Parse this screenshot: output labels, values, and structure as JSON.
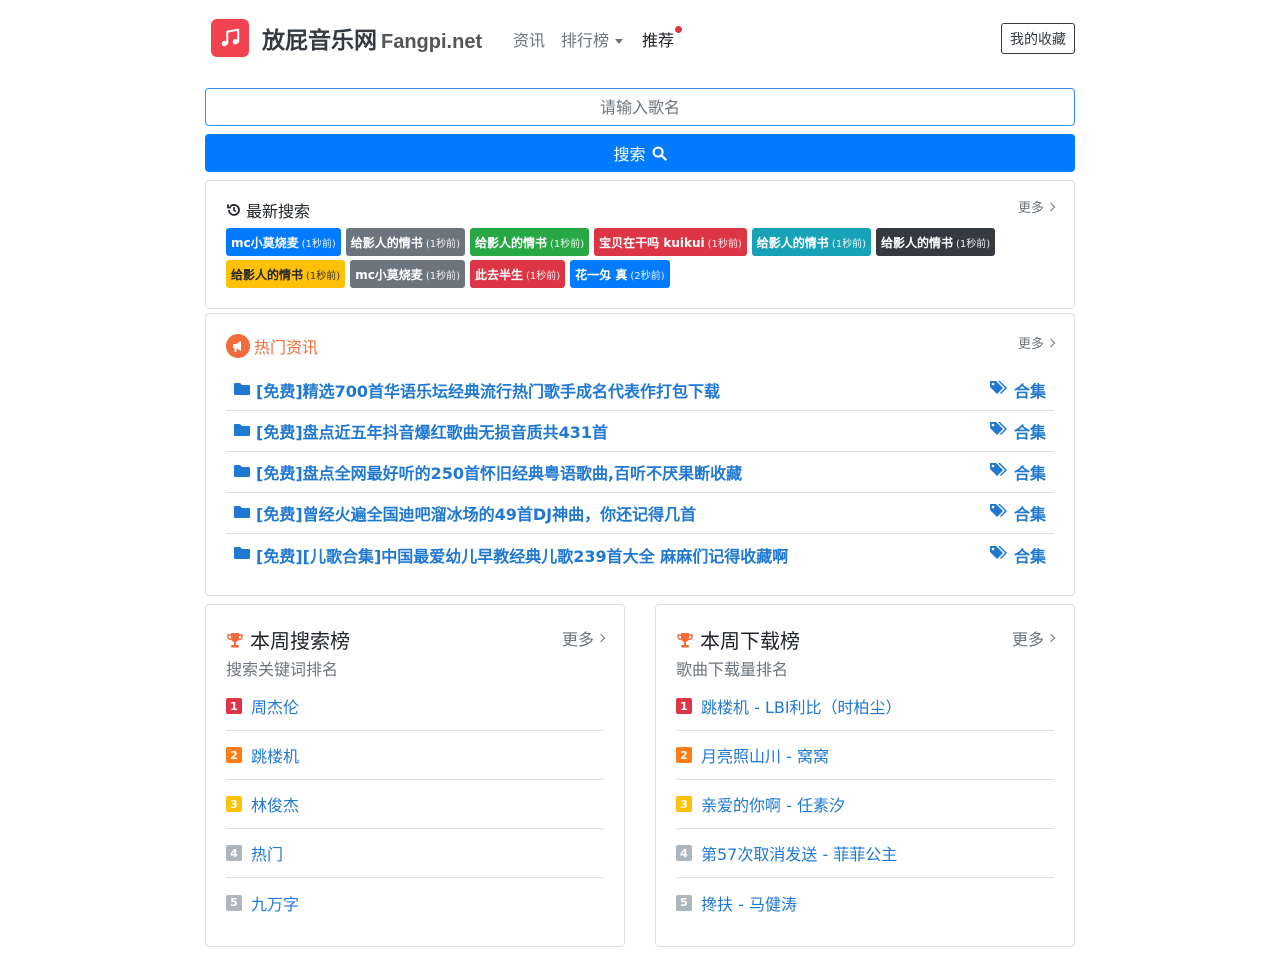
{
  "header": {
    "brand_cn": "放屁音乐网",
    "brand_en": "Fangpi.net",
    "nav": [
      "资讯",
      "排行榜",
      "推荐"
    ],
    "favorites": "我的收藏"
  },
  "search": {
    "placeholder": "请输入歌名",
    "button": "搜索"
  },
  "latest": {
    "title": "最新搜索",
    "more": "更多",
    "tags": [
      {
        "text": "mc小莫烧麦",
        "time": "(1秒前)",
        "color": "#007bff"
      },
      {
        "text": "给影人的情书",
        "time": "(1秒前)",
        "color": "#6c757d"
      },
      {
        "text": "给影人的情书",
        "time": "(1秒前)",
        "color": "#28a745"
      },
      {
        "text": "宝贝在干吗 kuikui",
        "time": "(1秒前)",
        "color": "#dc3545"
      },
      {
        "text": "给影人的情书",
        "time": "(1秒前)",
        "color": "#17a2b8"
      },
      {
        "text": "给影人的情书",
        "time": "(1秒前)",
        "color": "#343a40"
      },
      {
        "text": "给影人的情书",
        "time": "(1秒前)",
        "color": "#ffc107"
      },
      {
        "text": "mc小莫烧麦",
        "time": "(1秒前)",
        "color": "#6c757d"
      },
      {
        "text": "此去半生",
        "time": "(1秒前)",
        "color": "#dc3545"
      },
      {
        "text": "花一匁 真",
        "time": "(2秒前)",
        "color": "#007bff"
      }
    ]
  },
  "hotnews": {
    "title": "热门资讯",
    "more": "更多",
    "items": [
      {
        "title": "[免费]精选700首华语乐坛经典流行热门歌手成名代表作打包下载",
        "tag": "合集"
      },
      {
        "title": "[免费]盘点近五年抖音爆红歌曲无损音质共431首",
        "tag": "合集"
      },
      {
        "title": "[免费]盘点全网最好听的250首怀旧经典粤语歌曲,百听不厌果断收藏",
        "tag": "合集"
      },
      {
        "title": "[免费]曾经火遍全国迪吧溜冰场的49首DJ神曲，你还记得几首",
        "tag": "合集"
      },
      {
        "title": "[免费][儿歌合集]中国最爱幼儿早教经典儿歌239首大全 麻麻们记得收藏啊",
        "tag": "合集"
      }
    ]
  },
  "weekly_search": {
    "title": "本周搜索榜",
    "subtitle": "搜索关键词排名",
    "more": "更多",
    "items": [
      {
        "rank": "1",
        "text": "周杰伦"
      },
      {
        "rank": "2",
        "text": "跳楼机"
      },
      {
        "rank": "3",
        "text": "林俊杰"
      },
      {
        "rank": "4",
        "text": "热门"
      },
      {
        "rank": "5",
        "text": "九万字"
      }
    ]
  },
  "weekly_download": {
    "title": "本周下载榜",
    "subtitle": "歌曲下载量排名",
    "more": "更多",
    "items": [
      {
        "rank": "1",
        "text": "跳楼机 - LBI利比（时柏尘）"
      },
      {
        "rank": "2",
        "text": "月亮照山川 - 窝窝"
      },
      {
        "rank": "3",
        "text": "亲爱的你啊 - 任素汐"
      },
      {
        "rank": "4",
        "text": "第57次取消发送 - 菲菲公主"
      },
      {
        "rank": "5",
        "text": "搀扶 - 马健涛"
      }
    ]
  },
  "rank_colors": [
    "#dc3545",
    "#fd7e14",
    "#ffc107",
    "#adb5bd",
    "#adb5bd"
  ],
  "colors": {
    "primary": "#007bff",
    "link": "#1f78d1",
    "accent_orange": "#f26b3a"
  }
}
